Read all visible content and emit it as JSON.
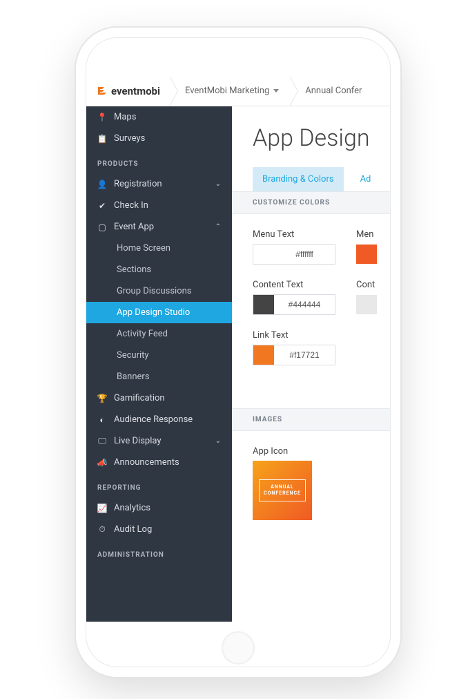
{
  "header": {
    "logo_text": "eventmobi",
    "crumbs": [
      {
        "label": "EventMobi Marketing",
        "has_dropdown": true
      },
      {
        "label": "Annual Confer",
        "has_dropdown": false
      }
    ]
  },
  "sidebar": {
    "top_items": [
      {
        "icon": "pin-icon",
        "glyph": "📍",
        "label": "Maps"
      },
      {
        "icon": "clipboard-icon",
        "glyph": "📋",
        "label": "Surveys"
      }
    ],
    "sections": [
      {
        "title": "PRODUCTS",
        "items": [
          {
            "icon": "user-plus-icon",
            "glyph": "👤",
            "label": "Registration",
            "chevron": "down"
          },
          {
            "icon": "check-icon",
            "glyph": "✔",
            "label": "Check In"
          },
          {
            "icon": "tablet-icon",
            "glyph": "▢",
            "label": "Event App",
            "chevron": "up",
            "children": [
              {
                "label": "Home Screen"
              },
              {
                "label": "Sections"
              },
              {
                "label": "Group Discussions"
              },
              {
                "label": "App Design Studio",
                "active": true
              },
              {
                "label": "Activity Feed"
              },
              {
                "label": "Security"
              },
              {
                "label": "Banners"
              }
            ]
          },
          {
            "icon": "trophy-icon",
            "glyph": "🏆",
            "label": "Gamification"
          },
          {
            "icon": "pie-icon",
            "glyph": "◐",
            "label": "Audience Response"
          },
          {
            "icon": "display-icon",
            "glyph": "🖵",
            "label": "Live Display",
            "chevron": "down"
          },
          {
            "icon": "megaphone-icon",
            "glyph": "📣",
            "label": "Announcements"
          }
        ]
      },
      {
        "title": "REPORTING",
        "items": [
          {
            "icon": "chart-icon",
            "glyph": "📈",
            "label": "Analytics"
          },
          {
            "icon": "gauge-icon",
            "glyph": "⏱",
            "label": "Audit Log"
          }
        ]
      },
      {
        "title": "ADMINISTRATION",
        "items": []
      }
    ]
  },
  "main": {
    "page_title": "App Design",
    "tabs": [
      {
        "label": "Branding & Colors",
        "active": true
      },
      {
        "label": "Ad",
        "active": false
      }
    ],
    "bands": {
      "colors": "CUSTOMIZE COLORS",
      "images": "IMAGES"
    },
    "color_controls": [
      [
        {
          "label": "Menu Text",
          "hex": "#ffffff",
          "swatch": "#ffffff"
        },
        {
          "label": "Men",
          "hex": "",
          "swatch": "#f05a24",
          "label_only": true
        }
      ],
      [
        {
          "label": "Content Text",
          "hex": "#444444",
          "swatch": "#444444"
        },
        {
          "label": "Cont",
          "hex": "",
          "swatch": "#e8e8e8",
          "label_only": true
        }
      ],
      [
        {
          "label": "Link Text",
          "hex": "#f17721",
          "swatch": "#f17721"
        }
      ]
    ],
    "images_section": {
      "label": "App Icon",
      "icon_text_line1": "ANNUAL",
      "icon_text_line2": "CONFERENCE"
    }
  }
}
